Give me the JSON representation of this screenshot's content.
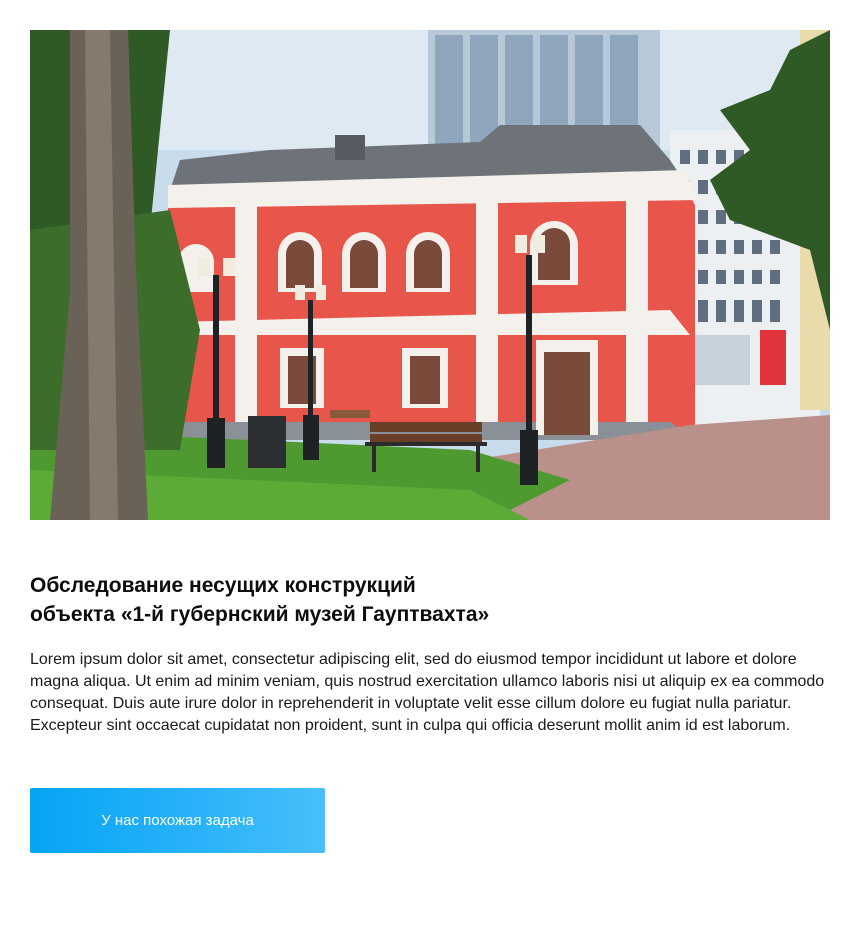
{
  "hero": {
    "image_alt": "Красное историческое здание с белыми пилястрами, скверик с фонарями и скамейками, на фоне современные высотки"
  },
  "project": {
    "title_line1": "Обследование несущих конструкций",
    "title_line2": "объекта «1-й губернский музей Гауптвахта»",
    "description": "Lorem ipsum dolor sit amet, consectetur adipiscing elit, sed do eiusmod tempor incididunt ut labore et dolore magna aliqua. Ut enim ad minim veniam, quis nostrud exercitation ullamco laboris nisi ut aliquip ex ea commodo consequat. Duis aute irure dolor in reprehenderit in voluptate velit esse cillum dolore eu fugiat nulla pariatur. Excepteur sint occaecat cupidatat non proident, sunt in culpa qui officia deserunt mollit anim id est laborum."
  },
  "cta": {
    "label": "У нас похожая задача"
  },
  "colors": {
    "accent": "#06a4f5",
    "accent_end": "#48bffb",
    "facade": "#e8564b",
    "trim": "#f4f1ec"
  }
}
